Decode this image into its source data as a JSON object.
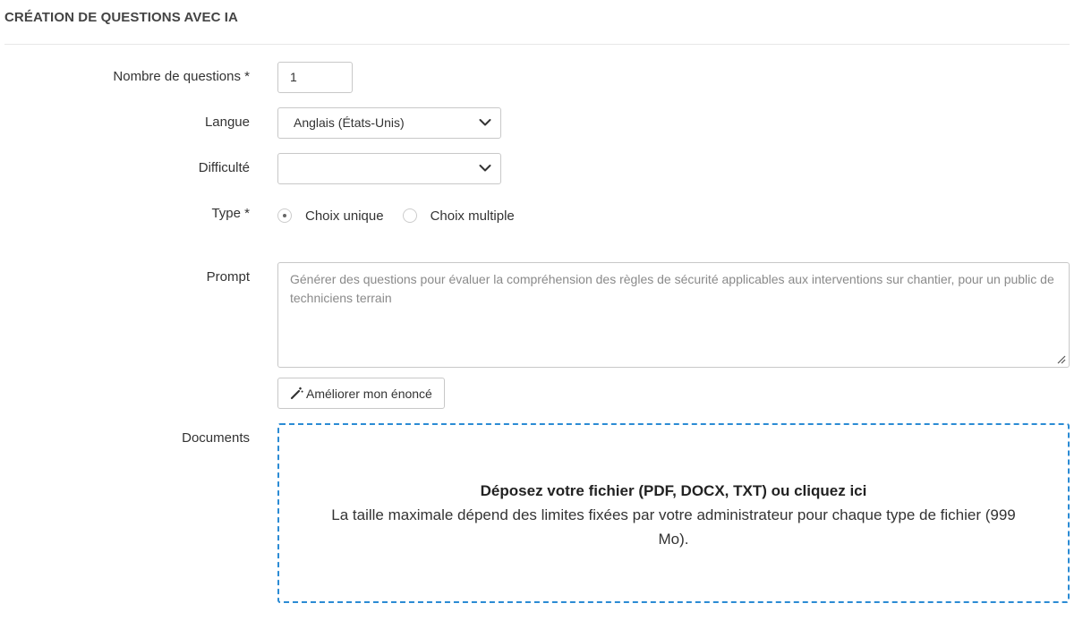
{
  "section": {
    "title": "CRÉATION DE QUESTIONS AVEC IA"
  },
  "form": {
    "nb_questions": {
      "label": "Nombre de questions *",
      "value": "1"
    },
    "langue": {
      "label": "Langue",
      "value": "Anglais (États-Unis)"
    },
    "difficulte": {
      "label": "Difficulté",
      "value": ""
    },
    "type": {
      "label": "Type *",
      "options": [
        {
          "label": "Choix unique",
          "checked": true
        },
        {
          "label": "Choix multiple",
          "checked": false
        }
      ]
    },
    "prompt": {
      "label": "Prompt",
      "placeholder": "Générer des questions pour évaluer la compréhension des règles de sécurité applicables aux interventions sur chantier, pour un public de techniciens terrain"
    },
    "improve_button": {
      "label": "Améliorer mon énoncé",
      "icon": "magic-wand-icon"
    },
    "documents": {
      "label": "Documents",
      "dropzone_title": "Déposez votre fichier (PDF, DOCX, TXT) ou cliquez ici",
      "dropzone_desc": "La taille maximale dépend des limites fixées par votre administrateur pour chaque type de fichier (999 Mo)."
    }
  },
  "colors": {
    "dropzone_border": "#2b8bd4",
    "input_border": "#c8c8c8"
  }
}
